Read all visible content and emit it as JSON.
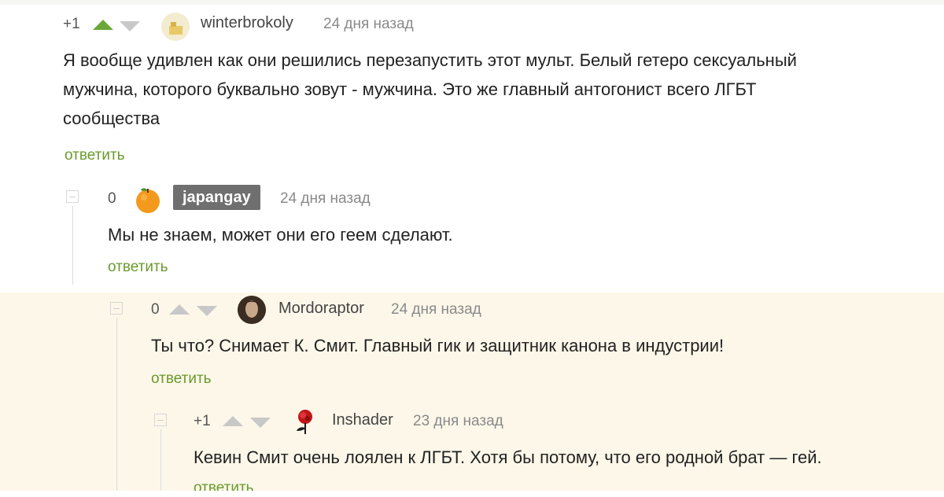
{
  "comments": [
    {
      "rating": "+1",
      "author": "winterbrokoly",
      "time": "24 дня назад",
      "text_lines": [
        "Я вообще удивлен как они решились перезапустить этот мульт. Белый гетеро сексуальный",
        "мужчина, которого буквально зовут - мужчина. Это же главный антогонист всего ЛГБТ",
        "сообщества"
      ],
      "reply": "ответить",
      "up_color": "#6aa83a",
      "down_color": "#c8c8c8"
    },
    {
      "rating": "0",
      "author": "japangay",
      "time": "24 дня назад",
      "text_lines": [
        "Мы не знаем, может они его геем сделают."
      ],
      "reply": "ответить",
      "avatar_icon": "orange-avatar-icon"
    },
    {
      "rating": "0",
      "author": "Mordoraptor",
      "time": "24 дня назад",
      "text_lines": [
        "Ты что? Снимает К. Смит. Главный гик и защитник канона в индустрии!"
      ],
      "reply": "ответить"
    },
    {
      "rating": "+1",
      "author": "Inshader",
      "time": "23 дня назад",
      "text_lines": [
        "Кевин Смит очень лоялен к ЛГБТ. Хотя бы потому, что его родной брат — гей."
      ],
      "reply": "ответить"
    }
  ],
  "colors": {
    "highlight_background": "#fcf7e9",
    "reply_link": "#6a9a2d",
    "tag_background": "#6f6f6f"
  }
}
